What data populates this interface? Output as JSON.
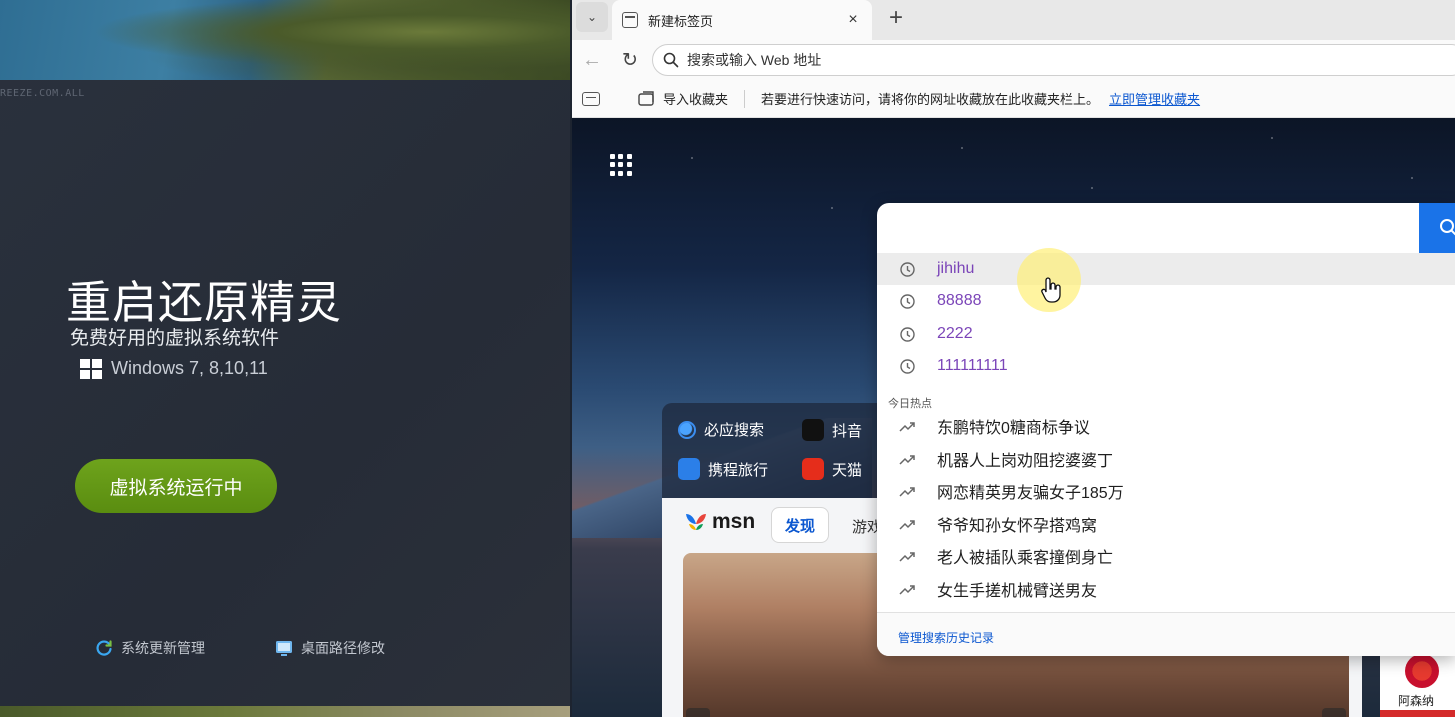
{
  "left_app": {
    "watermark": "REEZE.COM.ALL",
    "title": "重启还原精灵",
    "subtitle": "免费好用的虚拟系统软件",
    "os_support": "Windows  7, 8,10,11",
    "run_button": "虚拟系统运行中",
    "links": {
      "update": "系统更新管理",
      "desktop_path": "桌面路径修改"
    },
    "accent_color": "#65991a"
  },
  "browser": {
    "tab": {
      "title": "新建标签页",
      "close": "×"
    },
    "new_tab": "+",
    "address_bar": {
      "placeholder": "搜索或输入 Web 地址",
      "value": ""
    },
    "favorites_bar": {
      "import": "导入收藏夹",
      "hint": "若要进行快速访问，请将你的网址收藏放在此收藏夹栏上。",
      "manage_link": "立即管理收藏夹"
    },
    "quick_links": [
      {
        "label": "必应搜索",
        "icon": "bing-icon"
      },
      {
        "label": "抖音",
        "icon": "douyin-icon"
      },
      {
        "label": "携程旅行",
        "icon": "ctrip-icon"
      },
      {
        "label": "天猫",
        "icon": "tmall-icon"
      }
    ],
    "msn": {
      "logo": "msn",
      "tab_discover": "发现",
      "tab_games": "游戏"
    },
    "side_card": {
      "label": "阿森纳"
    },
    "search_dropdown": {
      "history": [
        "jihihu",
        "88888",
        "2222",
        "111111111"
      ],
      "hot_label": "今日热点",
      "trending": [
        "东鹏特饮0糖商标争议",
        "机器人上岗劝阻挖婆婆丁",
        "网恋精英男友骗女子185万",
        "爷爷知孙女怀孕搭鸡窝",
        "老人被插队乘客撞倒身亡",
        "女生手搓机械臂送男友"
      ],
      "footer_link": "管理搜索历史记录"
    }
  }
}
